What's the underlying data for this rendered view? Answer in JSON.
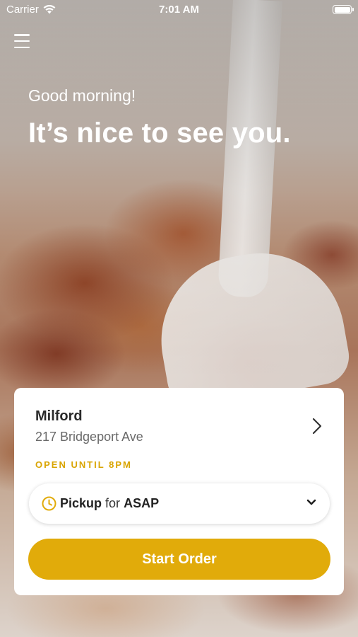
{
  "status_bar": {
    "carrier": "Carrier",
    "time": "7:01 AM"
  },
  "header": {
    "menu_icon": "hamburger-menu-icon",
    "greeting": "Good morning!",
    "headline": "It’s nice to see you."
  },
  "location_card": {
    "name": "Milford",
    "address": "217 Bridgeport Ave",
    "open_status": "OPEN UNTIL 8PM",
    "pickup": {
      "mode": "Pickup",
      "connector": "for",
      "time": "ASAP",
      "icon": "clock-icon"
    },
    "start_button": "Start Order"
  },
  "colors": {
    "accent": "#e1ab0a",
    "open_status": "#d9a400",
    "text_dark": "#2a2a2a",
    "text_muted": "#6a6a6a"
  }
}
